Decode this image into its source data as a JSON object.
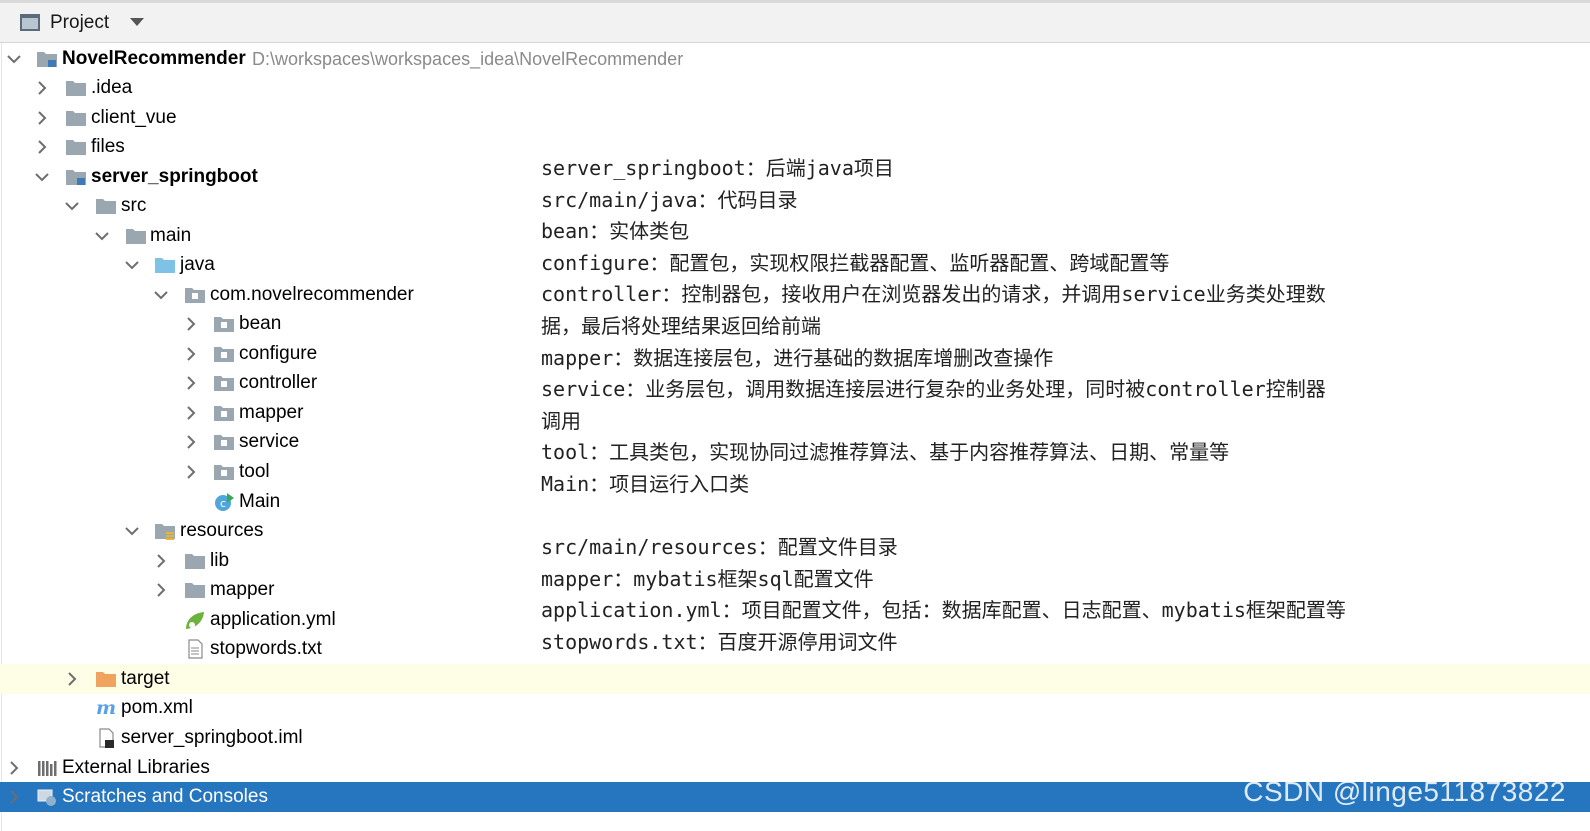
{
  "panel": {
    "title": "Project"
  },
  "tree": {
    "root": {
      "label": "NovelRecommender",
      "path": "D:\\workspaces\\workspaces_idea\\NovelRecommender"
    },
    "idea": ".idea",
    "client_vue": "client_vue",
    "files": "files",
    "server_springboot": "server_springboot",
    "src": "src",
    "main": "main",
    "java": "java",
    "package": "com.novelrecommender",
    "bean": "bean",
    "configure": "configure",
    "controller": "controller",
    "mapper": "mapper",
    "service": "service",
    "tool": "tool",
    "main_class": "Main",
    "resources": "resources",
    "lib": "lib",
    "res_mapper": "mapper",
    "application_yml": "application.yml",
    "stopwords": "stopwords.txt",
    "target": "target",
    "pom": "pom.xml",
    "iml": "server_springboot.iml",
    "external_libraries": "External Libraries",
    "scratches": "Scratches and Consoles"
  },
  "notes": [
    "server_springboot：后端java项目",
    "src/main/java：代码目录",
    "bean：实体类包",
    "configure：配置包，实现权限拦截器配置、监听器配置、跨域配置等",
    "controller：控制器包，接收用户在浏览器发出的请求，并调用service业务类处理数",
    "据，最后将处理结果返回给前端",
    "mapper：数据连接层包，进行基础的数据库增删改查操作",
    "service：业务层包，调用数据连接层进行复杂的业务处理，同时被controller控制器",
    "调用",
    "tool：工具类包，实现协同过滤推荐算法、基于内容推荐算法、日期、常量等",
    "Main：项目运行入口类",
    "",
    "src/main/resources：配置文件目录",
    "mapper：mybatis框架sql配置文件",
    "application.yml：项目配置文件，包括：数据库配置、日志配置、mybatis框架配置等",
    "stopwords.txt：百度开源停用词文件"
  ],
  "watermark": "CSDN @linge511873822",
  "colors": {
    "folder": "#9aa7b0",
    "source_folder": "#7ec3e6",
    "excluded_folder": "#f0a35e",
    "selection": "#2675bf",
    "highlight_row": "#fefde6"
  },
  "icons": {
    "chevron_right": "chevron-right-icon",
    "chevron_down": "chevron-down-icon",
    "folder": "folder-icon",
    "package": "package-icon",
    "class": "java-class-icon",
    "yml": "spring-config-icon",
    "text": "text-file-icon",
    "maven": "maven-icon",
    "module": "module-file-icon",
    "libraries": "libraries-icon",
    "scratches": "scratches-icon"
  }
}
